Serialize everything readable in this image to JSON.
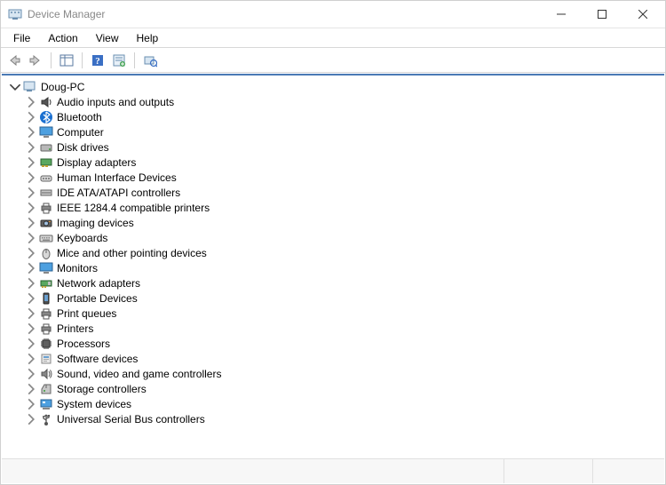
{
  "window": {
    "title": "Device Manager"
  },
  "menu": {
    "file": "File",
    "action": "Action",
    "view": "View",
    "help": "Help"
  },
  "tree": {
    "root": {
      "label": "Doug-PC",
      "icon": "computer-icon",
      "expanded": true
    },
    "nodes": [
      {
        "label": "Audio inputs and outputs",
        "icon": "audio-icon"
      },
      {
        "label": "Bluetooth",
        "icon": "bluetooth-icon"
      },
      {
        "label": "Computer",
        "icon": "monitor-icon"
      },
      {
        "label": "Disk drives",
        "icon": "disk-icon"
      },
      {
        "label": "Display adapters",
        "icon": "display-adapter-icon"
      },
      {
        "label": "Human Interface Devices",
        "icon": "hid-icon"
      },
      {
        "label": "IDE ATA/ATAPI controllers",
        "icon": "ide-icon"
      },
      {
        "label": "IEEE 1284.4 compatible printers",
        "icon": "printer-icon"
      },
      {
        "label": "Imaging devices",
        "icon": "imaging-icon"
      },
      {
        "label": "Keyboards",
        "icon": "keyboard-icon"
      },
      {
        "label": "Mice and other pointing devices",
        "icon": "mouse-icon"
      },
      {
        "label": "Monitors",
        "icon": "monitor-icon"
      },
      {
        "label": "Network adapters",
        "icon": "network-icon"
      },
      {
        "label": "Portable Devices",
        "icon": "portable-icon"
      },
      {
        "label": "Print queues",
        "icon": "printer-icon"
      },
      {
        "label": "Printers",
        "icon": "printer-icon"
      },
      {
        "label": "Processors",
        "icon": "processor-icon"
      },
      {
        "label": "Software devices",
        "icon": "software-icon"
      },
      {
        "label": "Sound, video and game controllers",
        "icon": "sound-icon"
      },
      {
        "label": "Storage controllers",
        "icon": "storage-icon"
      },
      {
        "label": "System devices",
        "icon": "system-icon"
      },
      {
        "label": "Universal Serial Bus controllers",
        "icon": "usb-icon"
      }
    ]
  }
}
